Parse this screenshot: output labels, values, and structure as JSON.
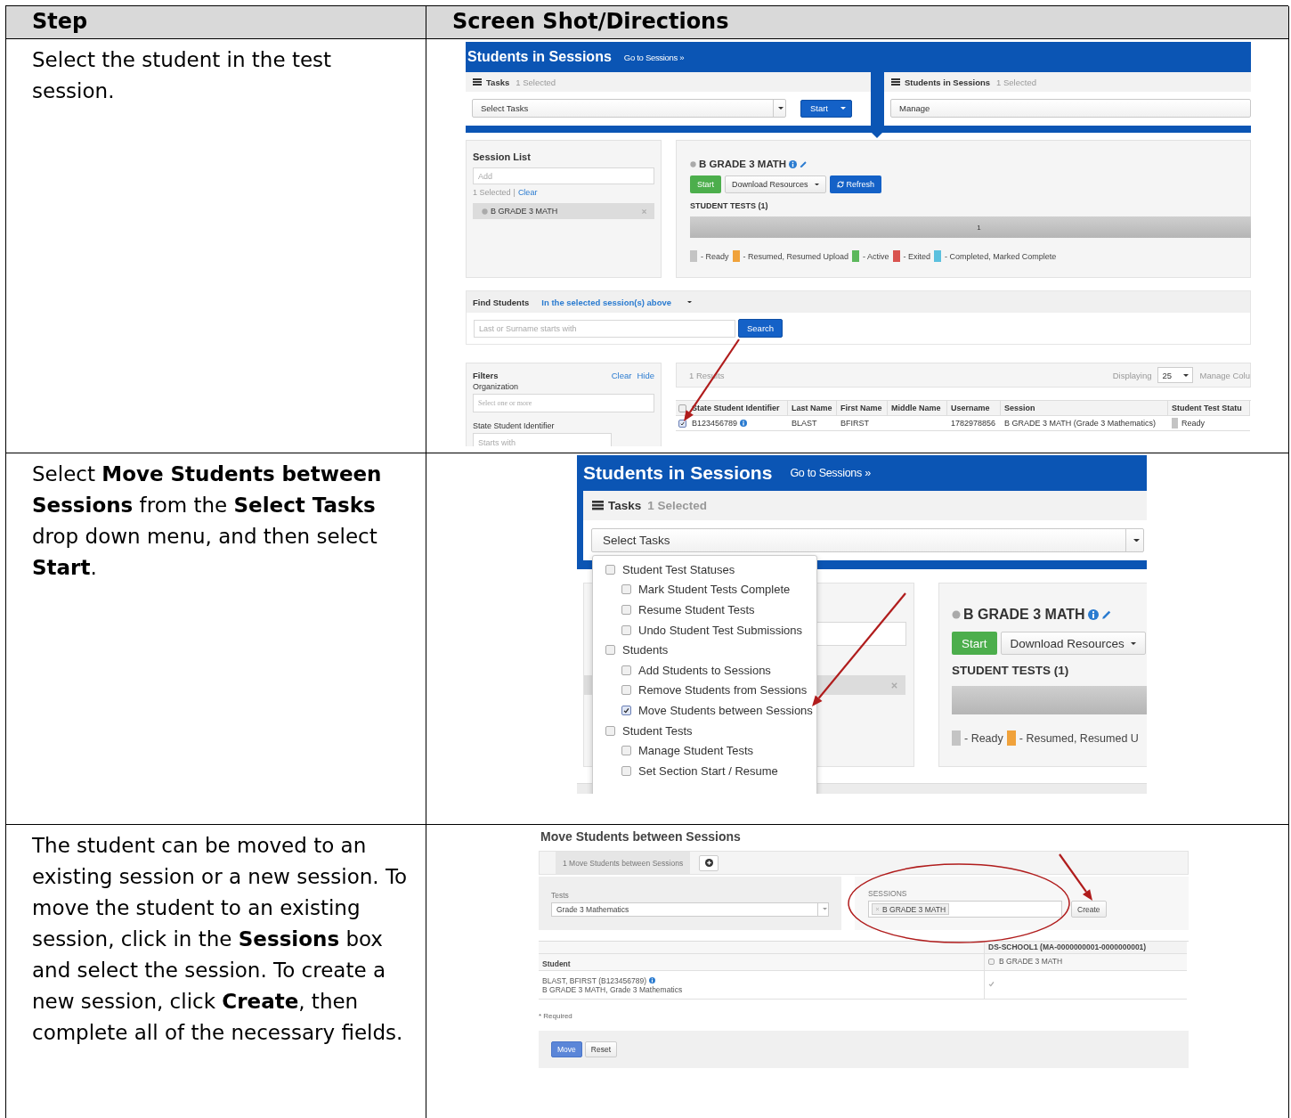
{
  "columns": [
    "Step",
    "Screen Shot/Directions"
  ],
  "steps": [
    {
      "text": "Select the student in the test session.",
      "screen": {
        "kind": "overview",
        "header": {
          "title": "Students in Sessions",
          "link": "Go to Sessions »"
        },
        "tasks_panel": {
          "title": "Tasks",
          "count": "1 Selected",
          "select": "Select Tasks",
          "button": "Start"
        },
        "sis_panel": {
          "title": "Students in Sessions",
          "count": "1 Selected",
          "select": "Manage"
        },
        "session_list": {
          "title": "Session List",
          "placeholder": "Add",
          "selected_count": "1 Selected",
          "separator": "|",
          "clear": "Clear",
          "items": [
            {
              "label": "B GRADE 3 MATH",
              "selected": true
            }
          ]
        },
        "session_detail": {
          "title": "B GRADE 3 MATH",
          "buttons": [
            {
              "label": "Start",
              "kind": "success"
            },
            {
              "label": "Download Resources",
              "kind": "dropdown"
            },
            {
              "label": "Refresh",
              "kind": "refresh"
            }
          ],
          "student_tests": "STUDENT TESTS (1)",
          "bar_label": "1",
          "legend": [
            {
              "label": "- Ready",
              "color": "#c4c4c4"
            },
            {
              "label": "- Resumed, Resumed Upload",
              "color": "#f0a23b"
            },
            {
              "label": "- Active",
              "color": "#5cb85c"
            },
            {
              "label": "- Exited",
              "color": "#d9534f"
            },
            {
              "label": "- Completed, Marked Complete",
              "color": "#5bc0de"
            }
          ]
        },
        "find_students": {
          "title": "Find Students",
          "scope": "In the selected session(s) above",
          "placeholder": "Last or Surname starts with",
          "button": "Search"
        },
        "filters": {
          "title": "Filters",
          "clear": "Clear",
          "hide": "Hide",
          "fields": [
            {
              "label": "Organization",
              "placeholder": "Select one or more"
            },
            {
              "label": "State Student Identifier",
              "placeholder": "Starts with"
            }
          ]
        },
        "results": {
          "count": "1 Results",
          "displaying": "Displaying",
          "page_size": "25",
          "manage": "Manage Colu",
          "header_checked": false,
          "columns": [
            "State Student Identifier",
            "Last Name",
            "First Name",
            "Middle Name",
            "Username",
            "Session",
            "Student Test Statu"
          ],
          "rows": [
            {
              "checked": true,
              "ssid": "B123456789",
              "last_name": "BLAST",
              "first_name": "BFIRST",
              "username": "1782978856",
              "session": "B GRADE 3 MATH (Grade 3 Mathematics)",
              "status": "Ready"
            }
          ]
        }
      }
    },
    {
      "text": "Select **Move Students between Sessions** from the **Select Tasks** drop down menu, and then select **Start**.",
      "screen": {
        "kind": "task_menu",
        "header": {
          "title": "Students in Sessions",
          "link": "Go to Sessions »"
        },
        "tasks_panel": {
          "title": "Tasks",
          "count": "1 Selected",
          "select": "Select Tasks"
        },
        "menu": [
          {
            "label": "Student Test Statuses",
            "checked": false,
            "children": [
              {
                "label": "Mark Student Tests Complete",
                "checked": false
              },
              {
                "label": "Resume Student Tests",
                "checked": false
              },
              {
                "label": "Undo Student Test Submissions",
                "checked": false
              }
            ]
          },
          {
            "label": "Students",
            "checked": false,
            "children": [
              {
                "label": "Add Students to Sessions",
                "checked": false
              },
              {
                "label": "Remove Students from Sessions",
                "checked": false
              },
              {
                "label": "Move Students between Sessions",
                "checked": true
              }
            ]
          },
          {
            "label": "Student Tests",
            "checked": false,
            "children": [
              {
                "label": "Manage Student Tests",
                "checked": false
              },
              {
                "label": "Set Section Start / Resume",
                "checked": false
              }
            ]
          }
        ],
        "session_detail": {
          "title": "B GRADE 3 MATH",
          "buttons": [
            {
              "label": "Start",
              "kind": "success"
            },
            {
              "label": "Download Resources",
              "kind": "dropdown"
            }
          ],
          "student_tests": "STUDENT TESTS (1)",
          "legend": [
            {
              "label": "- Ready",
              "color": "#c4c4c4"
            },
            {
              "label": "- Resumed, Resumed U",
              "color": "#f0a23b"
            }
          ]
        }
      }
    },
    {
      "text": "The student can be moved to an existing session or a new session. To move the student to an existing session, click in the **Sessions** box and select the session. To create a new session, click **Create**, then complete all of the necessary fields.",
      "screen": {
        "kind": "move_form",
        "title": "Move Students between Sessions",
        "tab": "1 Move Students between Sessions",
        "tests": {
          "label": "Tests",
          "value": "Grade 3 Mathematics"
        },
        "sessions": {
          "label": "SESSIONS",
          "token": "B GRADE 3 MATH",
          "button": "Create"
        },
        "table": {
          "group": "DS-SCHOOL1 (MA-0000000001-0000000001)",
          "student_header": "Student",
          "session_header": "B GRADE 3 MATH",
          "session_checked": false,
          "rows": [
            {
              "name": "BLAST, BFIRST (B123456789)",
              "detail": "B GRADE 3 MATH, Grade 3 Mathematics",
              "checked": true
            }
          ]
        },
        "required": "* Required",
        "buttons": [
          {
            "label": "Move",
            "kind": "primary"
          },
          {
            "label": "Reset",
            "kind": "default"
          }
        ]
      }
    }
  ]
}
